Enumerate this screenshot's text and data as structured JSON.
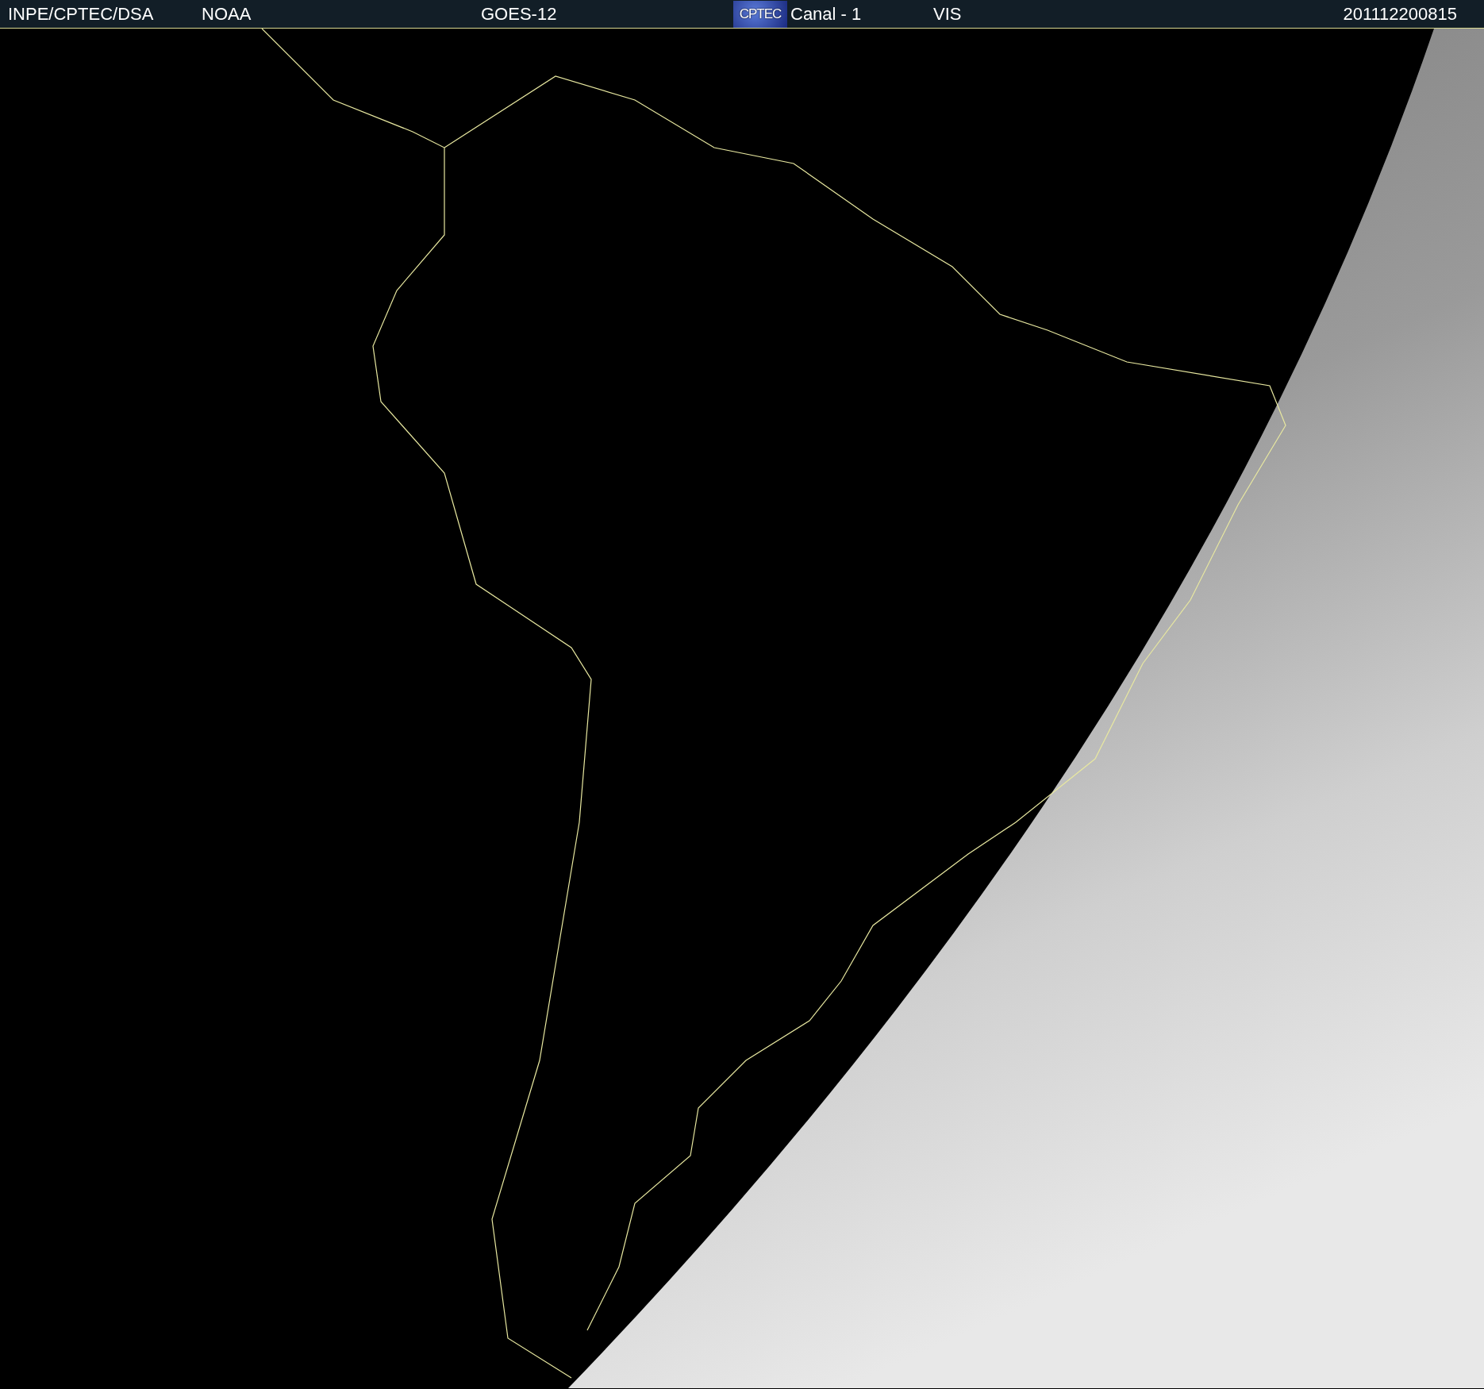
{
  "header": {
    "source": "INPE/CPTEC/DSA",
    "agency": "NOAA",
    "satellite": "GOES-12",
    "logo": "CPTEC",
    "channel": "Canal - 1",
    "band": "VIS",
    "timestamp": "201112200815"
  }
}
